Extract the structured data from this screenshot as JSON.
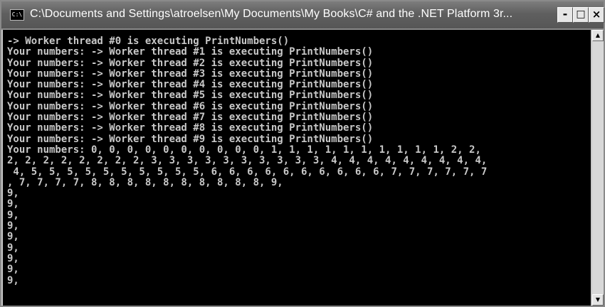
{
  "window": {
    "title": "C:\\Documents and Settings\\atroelsen\\My Documents\\My Books\\C# and the .NET Platform 3r...",
    "icon": "cmd-icon",
    "icon_text": "C:\\",
    "buttons": {
      "minimize": "-",
      "maximize": "□",
      "close": "×"
    }
  },
  "console": {
    "lines": [
      "-> Worker thread #0 is executing PrintNumbers()",
      "Your numbers: -> Worker thread #1 is executing PrintNumbers()",
      "Your numbers: -> Worker thread #2 is executing PrintNumbers()",
      "Your numbers: -> Worker thread #3 is executing PrintNumbers()",
      "Your numbers: -> Worker thread #4 is executing PrintNumbers()",
      "Your numbers: -> Worker thread #5 is executing PrintNumbers()",
      "Your numbers: -> Worker thread #6 is executing PrintNumbers()",
      "Your numbers: -> Worker thread #7 is executing PrintNumbers()",
      "Your numbers: -> Worker thread #8 is executing PrintNumbers()",
      "Your numbers: -> Worker thread #9 is executing PrintNumbers()",
      "Your numbers: 0, 0, 0, 0, 0, 0, 0, 0, 0, 0, 1, 1, 1, 1, 1, 1, 1, 1, 1, 1, 2, 2,",
      "2, 2, 2, 2, 2, 2, 2, 2, 3, 3, 3, 3, 3, 3, 3, 3, 3, 3, 4, 4, 4, 4, 4, 4, 4, 4, 4,",
      " 4, 5, 5, 5, 5, 5, 5, 5, 5, 5, 5, 6, 6, 6, 6, 6, 6, 6, 6, 6, 6, 7, 7, 7, 7, 7, 7",
      ", 7, 7, 7, 7, 8, 8, 8, 8, 8, 8, 8, 8, 8, 8, 9,",
      "9,",
      "9,",
      "9,",
      "9,",
      "9,",
      "9,",
      "9,",
      "9,",
      "9,"
    ]
  },
  "scrollbar": {
    "up_arrow": "▲",
    "down_arrow": "▼"
  },
  "colors": {
    "console_background": "#000000",
    "console_text": "#c8c8c8",
    "titlebar": "#5f5f5f"
  }
}
